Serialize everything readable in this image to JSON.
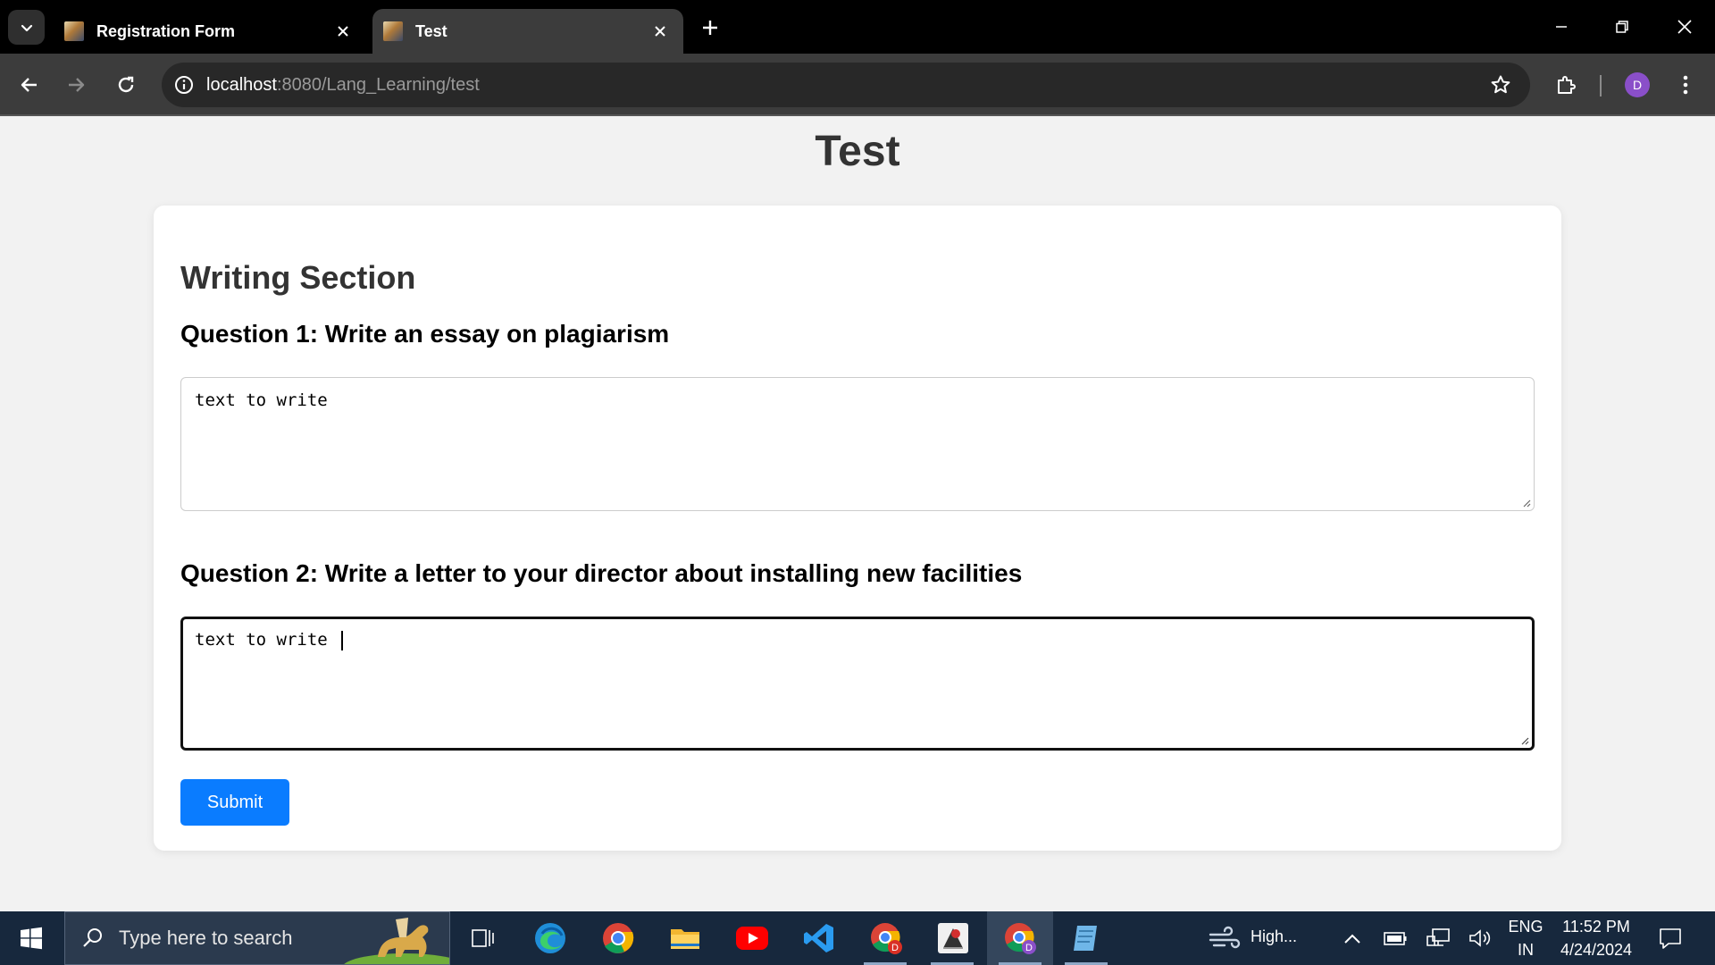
{
  "browser": {
    "tabs": [
      {
        "title": "Registration Form",
        "active": false
      },
      {
        "title": "Test",
        "active": true
      }
    ],
    "url_host": "localhost",
    "url_path": ":8080/Lang_Learning/test",
    "profile_initial": "D"
  },
  "page": {
    "title": "Test",
    "section_title": "Writing Section",
    "question1": "Question 1: Write an essay on plagiarism",
    "answer1": "text to write",
    "question2": "Question 2: Write a letter to your director about installing new facilities",
    "answer2": "text to write ",
    "submit_label": "Submit"
  },
  "taskbar": {
    "search_placeholder": "Type here to search",
    "weather_text": "High...",
    "lang_line1": "ENG",
    "lang_line2": "IN",
    "time": "11:52 PM",
    "date": "4/24/2024"
  },
  "colors": {
    "submit_bg": "#0a7cff",
    "avatar_bg": "#8a4fc9",
    "taskbar_bg": "#17283d"
  }
}
